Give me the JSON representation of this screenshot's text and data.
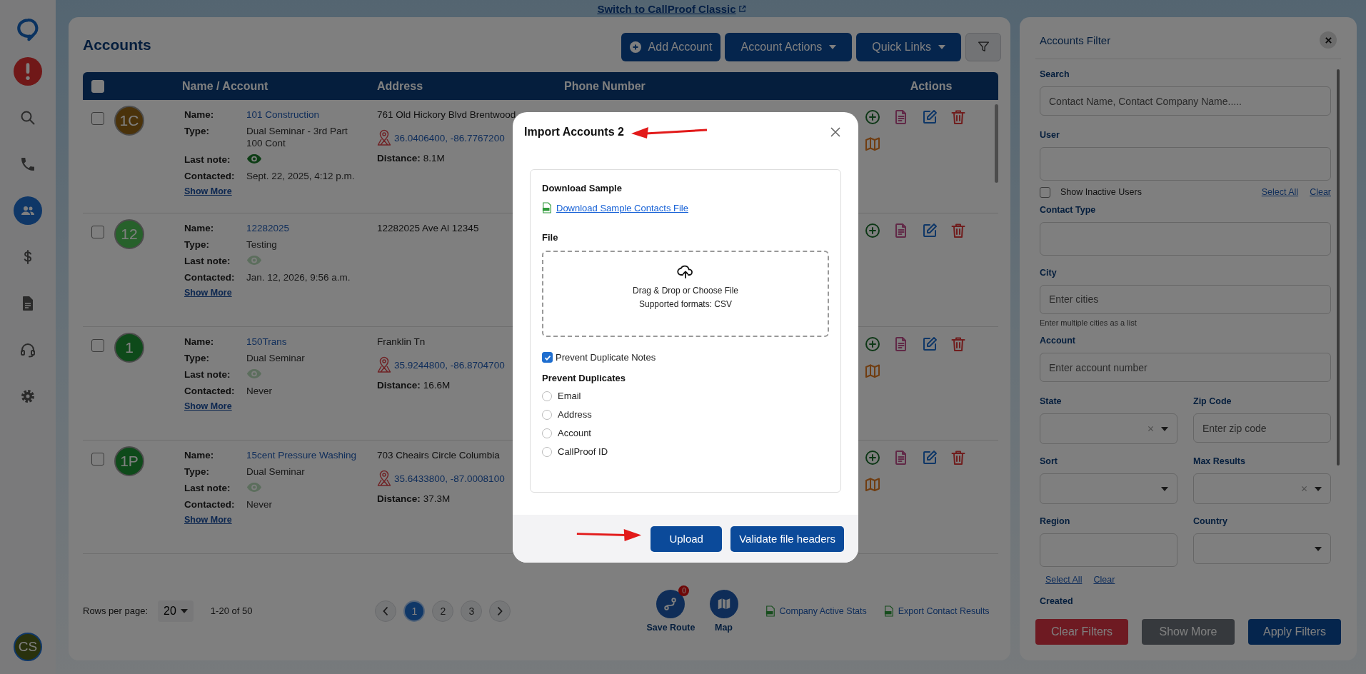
{
  "top_link": "Switch to CallProof Classic",
  "sidebar": {
    "items": [
      {
        "kind": "alert",
        "selected": false
      },
      {
        "kind": "search",
        "selected": false
      },
      {
        "kind": "phone",
        "selected": false
      },
      {
        "kind": "contacts",
        "selected": true
      },
      {
        "kind": "dollar",
        "selected": false
      },
      {
        "kind": "document",
        "selected": false
      },
      {
        "kind": "headset",
        "selected": false
      },
      {
        "kind": "settings",
        "selected": false
      }
    ],
    "avatar": "CS"
  },
  "accounts": {
    "title": "Accounts",
    "toolbar": [
      {
        "kind": "add",
        "label": "Add Account"
      },
      {
        "kind": "dropdown",
        "label": "Account Actions"
      },
      {
        "kind": "dropdown",
        "label": "Quick Links"
      },
      {
        "kind": "filter"
      }
    ],
    "table": {
      "select_all_checked": false,
      "columns": [
        "Name / Account",
        "Address",
        "Phone Number",
        "Actions"
      ],
      "rows": [
        {
          "checked": false,
          "avatar": "1C",
          "color": "#4a320a",
          "fields": [
            {
              "kind": "link",
              "label": "Name:",
              "value": "101 Construction"
            },
            {
              "kind": "text",
              "label": "Type:",
              "value": "Dual Seminar - 3rd Part 100 Cont"
            },
            {
              "kind": "note",
              "label": "Last note:",
              "has_note": true
            },
            {
              "kind": "text",
              "label": "Contacted:",
              "value": "Sept. 22, 2025, 4:12 p.m."
            }
          ],
          "show_more": "Show More",
          "address": "761 Old Hickory Blvd Brentwood",
          "coords": "36.0406400, -86.7767200",
          "distance_label": "Distance:",
          "distance": "8.1M",
          "actions": [
            {
              "kind": "add"
            },
            {
              "kind": "notes"
            },
            {
              "kind": "edit"
            },
            {
              "kind": "delete"
            },
            {
              "kind": "map"
            }
          ]
        },
        {
          "checked": false,
          "avatar": "12",
          "color": "#27612b",
          "fields": [
            {
              "kind": "link",
              "label": "Name:",
              "value": "12282025"
            },
            {
              "kind": "text",
              "label": "Type:",
              "value": "Testing"
            },
            {
              "kind": "note",
              "label": "Last note:",
              "has_note": false
            },
            {
              "kind": "text",
              "label": "Contacted:",
              "value": "Jan. 12, 2026, 9:56 a.m."
            }
          ],
          "show_more": "Show More",
          "address": "12282025 Ave Al 12345",
          "actions": [
            {
              "kind": "add"
            },
            {
              "kind": "notes"
            },
            {
              "kind": "edit"
            },
            {
              "kind": "delete"
            }
          ]
        },
        {
          "checked": false,
          "avatar": "1",
          "color": "#0e4a1a",
          "fields": [
            {
              "kind": "link",
              "label": "Name:",
              "value": "150Trans"
            },
            {
              "kind": "text",
              "label": "Type:",
              "value": "Dual Seminar"
            },
            {
              "kind": "note",
              "label": "Last note:",
              "has_note": false
            },
            {
              "kind": "text",
              "label": "Contacted:",
              "value": "Never"
            }
          ],
          "show_more": "Show More",
          "address": "Franklin Tn",
          "coords": "35.9244800, -86.8704700",
          "distance_label": "Distance:",
          "distance": "16.6M",
          "actions": [
            {
              "kind": "add"
            },
            {
              "kind": "notes"
            },
            {
              "kind": "edit"
            },
            {
              "kind": "delete"
            },
            {
              "kind": "map"
            }
          ]
        },
        {
          "checked": false,
          "avatar": "1P",
          "color": "#0e4a1a",
          "fields": [
            {
              "kind": "link",
              "label": "Name:",
              "value": "15cent Pressure Washing"
            },
            {
              "kind": "text",
              "label": "Type:",
              "value": "Dual Seminar"
            },
            {
              "kind": "note",
              "label": "Last note:",
              "has_note": false
            },
            {
              "kind": "text",
              "label": "Contacted:",
              "value": "Never"
            }
          ],
          "show_more": "Show More",
          "address": "703 Cheairs Circle Columbia",
          "coords": "35.6433800, -87.0008100",
          "distance_label": "Distance:",
          "distance": "37.3M",
          "actions": [
            {
              "kind": "add"
            },
            {
              "kind": "notes"
            },
            {
              "kind": "edit"
            },
            {
              "kind": "delete"
            },
            {
              "kind": "map"
            }
          ]
        }
      ]
    },
    "footer": {
      "rows_label": "Rows per page:",
      "rows_value": "20",
      "range": "1-20 of 50",
      "pages": [
        {
          "label": "1",
          "selected": true
        },
        {
          "label": "2",
          "selected": false
        },
        {
          "label": "3",
          "selected": false
        }
      ],
      "route_badge": "0",
      "route_label": "Save Route",
      "map_label": "Map",
      "links": [
        "Company Active Stats",
        "Export Contact Results"
      ]
    }
  },
  "filter": {
    "title": "Accounts Filter",
    "sections": [
      {
        "kind": "field",
        "label": "Search",
        "control": {
          "kind": "text",
          "placeholder": "Contact Name, Contact Company Name....."
        }
      },
      {
        "kind": "field",
        "label": "User",
        "control": {
          "kind": "multi"
        }
      },
      {
        "kind": "checkbox",
        "label": "Show Inactive Users",
        "checked": false,
        "links": [
          "Select All",
          "Clear"
        ]
      },
      {
        "kind": "field",
        "label": "Contact Type",
        "control": {
          "kind": "multi"
        }
      },
      {
        "kind": "field",
        "label": "City",
        "control": {
          "kind": "text",
          "placeholder": "Enter cities"
        }
      },
      {
        "kind": "help",
        "text": "Enter multiple cities as a list"
      },
      {
        "kind": "field",
        "label": "Account",
        "control": {
          "kind": "text",
          "placeholder": "Enter account number"
        }
      },
      {
        "kind": "pair",
        "fields": [
          {
            "label": "State",
            "control": {
              "kind": "select",
              "clearable": true
            }
          },
          {
            "label": "Zip Code",
            "control": {
              "kind": "text",
              "placeholder": "Enter zip code"
            }
          }
        ]
      },
      {
        "kind": "pair",
        "fields": [
          {
            "label": "Sort",
            "control": {
              "kind": "select",
              "clearable": false
            }
          },
          {
            "label": "Max Results",
            "control": {
              "kind": "select",
              "clearable": true
            }
          }
        ]
      },
      {
        "kind": "pair",
        "fields": [
          {
            "label": "Region",
            "control": {
              "kind": "multi"
            }
          },
          {
            "label": "Country",
            "control": {
              "kind": "select",
              "clearable": false
            }
          }
        ]
      },
      {
        "kind": "links",
        "links": [
          "Select All",
          "Clear"
        ]
      },
      {
        "kind": "heading",
        "label": "Created"
      }
    ],
    "buttons": [
      {
        "kind": "danger",
        "label": "Clear Filters"
      },
      {
        "kind": "secondary",
        "label": "Show More"
      },
      {
        "kind": "primary",
        "label": "Apply Filters"
      }
    ]
  },
  "modal": {
    "title": "Import Accounts 2",
    "sample_heading": "Download Sample",
    "sample_link": "Download Sample Contacts File",
    "file_heading": "File",
    "drop_lines": [
      "Drag & Drop or Choose File",
      "Supported formats: CSV"
    ],
    "prevent_notes": {
      "label": "Prevent Duplicate Notes",
      "checked": true
    },
    "duplicates_heading": "Prevent Duplicates",
    "options": [
      {
        "label": "Email",
        "selected": false
      },
      {
        "label": "Address",
        "selected": false
      },
      {
        "label": "Account",
        "selected": false
      },
      {
        "label": "CallProof ID",
        "selected": false
      }
    ],
    "buttons": [
      {
        "kind": "primary",
        "label": "Upload"
      },
      {
        "kind": "primary",
        "label": "Validate file headers"
      }
    ]
  }
}
